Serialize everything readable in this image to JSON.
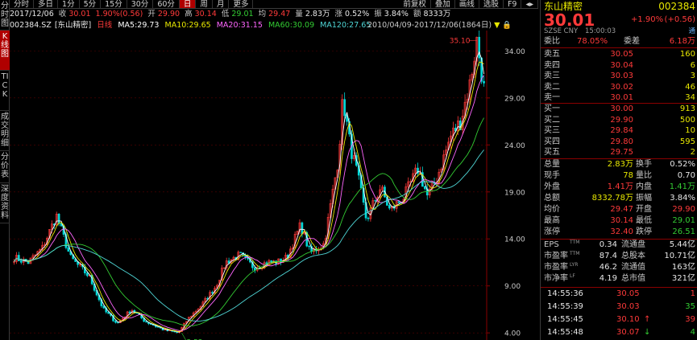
{
  "vtabs": [
    "分时图",
    "K线图",
    "TICK",
    "成交明细",
    "分价表",
    "深度资料"
  ],
  "toolbar": {
    "periods": [
      "分时",
      "多日",
      "1分",
      "5分",
      "15分",
      "30分",
      "60分",
      "日",
      "周",
      "月",
      "更多"
    ],
    "active": "日",
    "right": [
      "前复权",
      "叠加",
      "画线",
      "选股",
      "F9"
    ]
  },
  "info": {
    "date": "2017/12/06",
    "close_lbl": "收",
    "close": "30.01",
    "chg": "1.90%(0.56)",
    "open_lbl": "开",
    "open": "29.90",
    "high_lbl": "高",
    "high": "30.14",
    "low_lbl": "低",
    "low": "29.01",
    "avg_lbl": "均",
    "avg": "29.47",
    "vol_lbl": "量",
    "vol": "2.83万",
    "amp_lbl": "涨",
    "amp": "0.52%",
    "turn_lbl": "振",
    "turn": "3.84%",
    "amt_lbl": "额",
    "amt": "8333万"
  },
  "ma": {
    "code": "002384.SZ",
    "name": "[东山精密]",
    "period": "日线",
    "ma5": "MA5:29.73",
    "ma10": "MA10:29.65",
    "ma20": "MA20:31.15",
    "ma60": "MA60:30.09",
    "ma120": "MA120:27.65"
  },
  "range": "2010/04/09-2017/12/06(1864日)",
  "chart_data": {
    "type": "line",
    "ylim": [
      3.5,
      36
    ],
    "yticks": [
      "34.00",
      "29.00",
      "24.00",
      "19.00",
      "14.00",
      "9.00",
      "4.00"
    ],
    "max_label": "35.10",
    "min_label": "3.53",
    "x": [
      "2010/04",
      "2011",
      "2012",
      "2013",
      "2014",
      "2015/06",
      "2016",
      "2017",
      "2017/12"
    ],
    "series": [
      {
        "values": [
          12.5,
          15.0,
          8.5,
          4.5,
          6.0,
          29.0,
          20.0,
          22.0,
          30.01
        ]
      }
    ]
  },
  "quote": {
    "name": "东山精密",
    "code": "002384",
    "price": "30.01",
    "chg_pct": "+1.90%",
    "chg": "(+0.56)",
    "market": "SZSE CNY",
    "time": "15:00:03",
    "tag": "通",
    "wb_lbl": "委比",
    "wb": "78.05%",
    "wc_lbl": "委差",
    "wc": "6.18万",
    "asks": [
      {
        "l": "卖五",
        "p": "30.05",
        "v": "160"
      },
      {
        "l": "卖四",
        "p": "30.04",
        "v": "6"
      },
      {
        "l": "卖三",
        "p": "30.03",
        "v": "3"
      },
      {
        "l": "卖二",
        "p": "30.02",
        "v": "46"
      },
      {
        "l": "卖一",
        "p": "30.01",
        "v": "34"
      }
    ],
    "bids": [
      {
        "l": "买一",
        "p": "30.00",
        "v": "913"
      },
      {
        "l": "买二",
        "p": "29.90",
        "v": "500"
      },
      {
        "l": "买三",
        "p": "29.84",
        "v": "10"
      },
      {
        "l": "买四",
        "p": "29.80",
        "v": "595"
      },
      {
        "l": "买五",
        "p": "29.75",
        "v": "2"
      }
    ],
    "stats": [
      [
        "总量",
        "2.83万",
        "换手",
        "0.52%"
      ],
      [
        "现手",
        "78",
        "量比",
        "0.70"
      ],
      [
        "外盘",
        "1.41万",
        "内盘",
        "1.41万"
      ],
      [
        "总额",
        "8332.78万",
        "振幅",
        "3.84%"
      ],
      [
        "均价",
        "29.47",
        "开盘",
        "29.90"
      ],
      [
        "最高",
        "30.14",
        "最低",
        "29.01"
      ],
      [
        "涨停",
        "32.40",
        "跌停",
        "26.51"
      ]
    ],
    "fin": [
      [
        "EPS",
        "0.34",
        "流通盘",
        "5.44亿"
      ],
      [
        "市盈率",
        "87.4",
        "总股本",
        "10.71亿"
      ],
      [
        "市盈率",
        "46.2",
        "流通值",
        "163亿"
      ],
      [
        "市净率",
        "4.19",
        "总市值",
        "321亿"
      ]
    ],
    "ticks": [
      [
        "14:55:36",
        "30.05",
        "1"
      ],
      [
        "14:55:39",
        "30.03",
        "35"
      ],
      [
        "14:55:45",
        "30.10",
        "39"
      ],
      [
        "14:55:48",
        "30.07",
        "4"
      ]
    ]
  }
}
